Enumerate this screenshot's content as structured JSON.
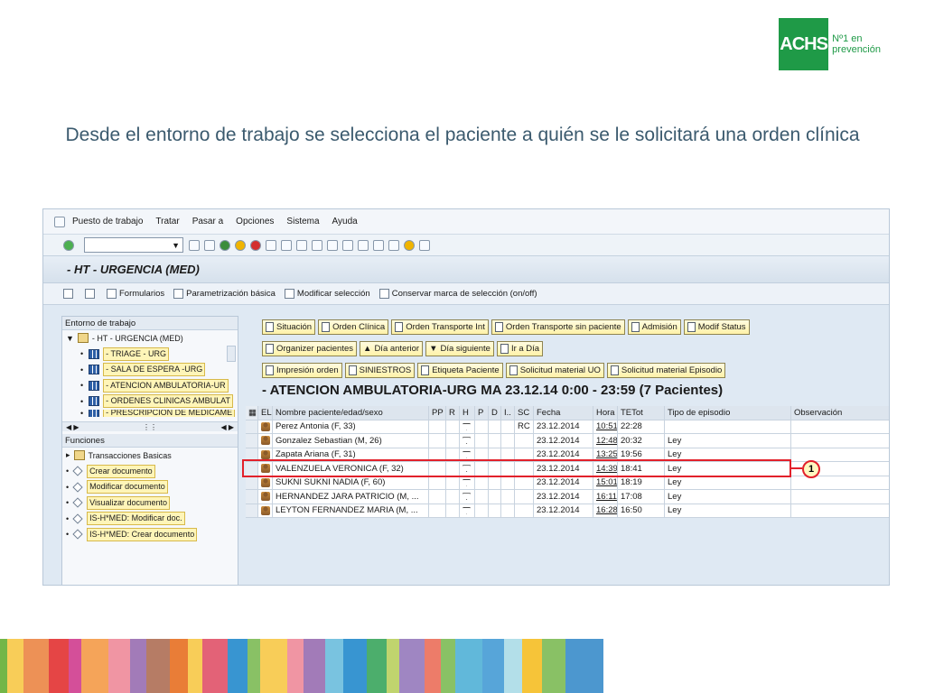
{
  "logo": {
    "mark": "ACHS",
    "line1": "Nº1 en",
    "line2": "prevención"
  },
  "headline": "Desde el entorno de trabajo se selecciona el paciente a quién se le solicitará una orden clínica",
  "sap": {
    "menu": [
      "Puesto de trabajo",
      "Tratar",
      "Pasar a",
      "Opciones",
      "Sistema",
      "Ayuda"
    ],
    "title": "- HT - URGENCIA (MED)",
    "app_toolbar": [
      "Formularios",
      "Parametrización básica",
      "Modificar selección",
      "Conservar marca de selección (on/off)"
    ],
    "left_panel": {
      "entorno_header": "Entorno de trabajo",
      "tree_root": "- HT - URGENCIA (MED)",
      "tree_items": [
        "- TRIAGE - URG",
        "- SALA DE ESPERA -URG",
        "- ATENCION AMBULATORIA-UR",
        "- ORDENES CLINICAS AMBULAT",
        "- PRESCRIPCION DE MEDICAME"
      ],
      "funciones_header": "Funciones",
      "funciones_folder": "Transacciones Basicas",
      "funciones_items": [
        "Crear documento",
        "Modificar documento",
        "Visualizar documento",
        "IS-H*MED: Modificar doc.",
        "IS-H*MED: Crear documento"
      ]
    },
    "button_rows": [
      [
        "Situación",
        "Orden Clínica",
        "Orden Transporte Int",
        "Orden Transporte sin paciente",
        "Admisión",
        "Modif Status"
      ],
      [
        "Organizer pacientes",
        "Día anterior",
        "Día siguiente",
        "Ir a Día"
      ],
      [
        "Impresión orden",
        "SINIESTROS",
        "Etiqueta Paciente",
        "Solicitud material UO",
        "Solicitud material Episodio"
      ]
    ],
    "list_title": "- ATENCION AMBULATORIA-URG MA 23.12.14  0:00 - 23:59 (7  Pacientes)",
    "columns": [
      "EL",
      "Nombre paciente/edad/sexo",
      "PP",
      "R",
      "H",
      "P",
      "D",
      "I..",
      "SC",
      "Fecha",
      "Hora",
      "TETot",
      "Tipo de episodio",
      "Observación"
    ],
    "rows": [
      {
        "name": "Perez Antonia (F, 33)",
        "sc": "RC",
        "fecha": "23.12.2014",
        "hora": "10:51",
        "tetot": "22:28",
        "tipo": ""
      },
      {
        "name": "Gonzalez Sebastian (M, 26)",
        "sc": "",
        "fecha": "23.12.2014",
        "hora": "12:48",
        "tetot": "20:32",
        "tipo": "Ley"
      },
      {
        "name": "Zapata Ariana (F, 31)",
        "sc": "",
        "fecha": "23.12.2014",
        "hora": "13:25",
        "tetot": "19:56",
        "tipo": "Ley"
      },
      {
        "name": "VALENZUELA VERONICA (F, 32)",
        "sc": "",
        "fecha": "23.12.2014",
        "hora": "14:39",
        "tetot": "18:41",
        "tipo": "Ley"
      },
      {
        "name": "SUKNI SUKNI NADIA (F, 60)",
        "sc": "",
        "fecha": "23.12.2014",
        "hora": "15:01",
        "tetot": "18:19",
        "tipo": "Ley"
      },
      {
        "name": "HERNANDEZ JARA PATRICIO (M, ...",
        "sc": "",
        "fecha": "23.12.2014",
        "hora": "16:11",
        "tetot": "17:08",
        "tipo": "Ley"
      },
      {
        "name": "LEYTON FERNANDEZ MARIA (M, ...",
        "sc": "",
        "fecha": "23.12.2014",
        "hora": "16:28",
        "tetot": "16:50",
        "tipo": "Ley"
      }
    ],
    "callout_number": "1"
  },
  "colors": {
    "brand_green": "#1f9a47",
    "highlight_red": "#e2212b",
    "stripes": [
      "#6bb23e",
      "#f6c12e",
      "#e8762c",
      "#e43b3b",
      "#c9237f",
      "#f28d30",
      "#ef8f9e",
      "#8b5aa6",
      "#a45b3e",
      "#e8762c",
      "#f6c12e",
      "#dc3b55",
      "#2d8fcf",
      "#6bb23e",
      "#f6c12e",
      "#ef8f9e",
      "#8b5aa6",
      "#58b4d8",
      "#2d8fcf",
      "#1f9a47",
      "#b0c94a",
      "#9a7fbf",
      "#e85b44",
      "#6bb23e",
      "#58b4d8",
      "#2d8fcf",
      "#a0d7e4",
      "#f6c12e",
      "#6bb23e",
      "#1f7dc3"
    ]
  }
}
